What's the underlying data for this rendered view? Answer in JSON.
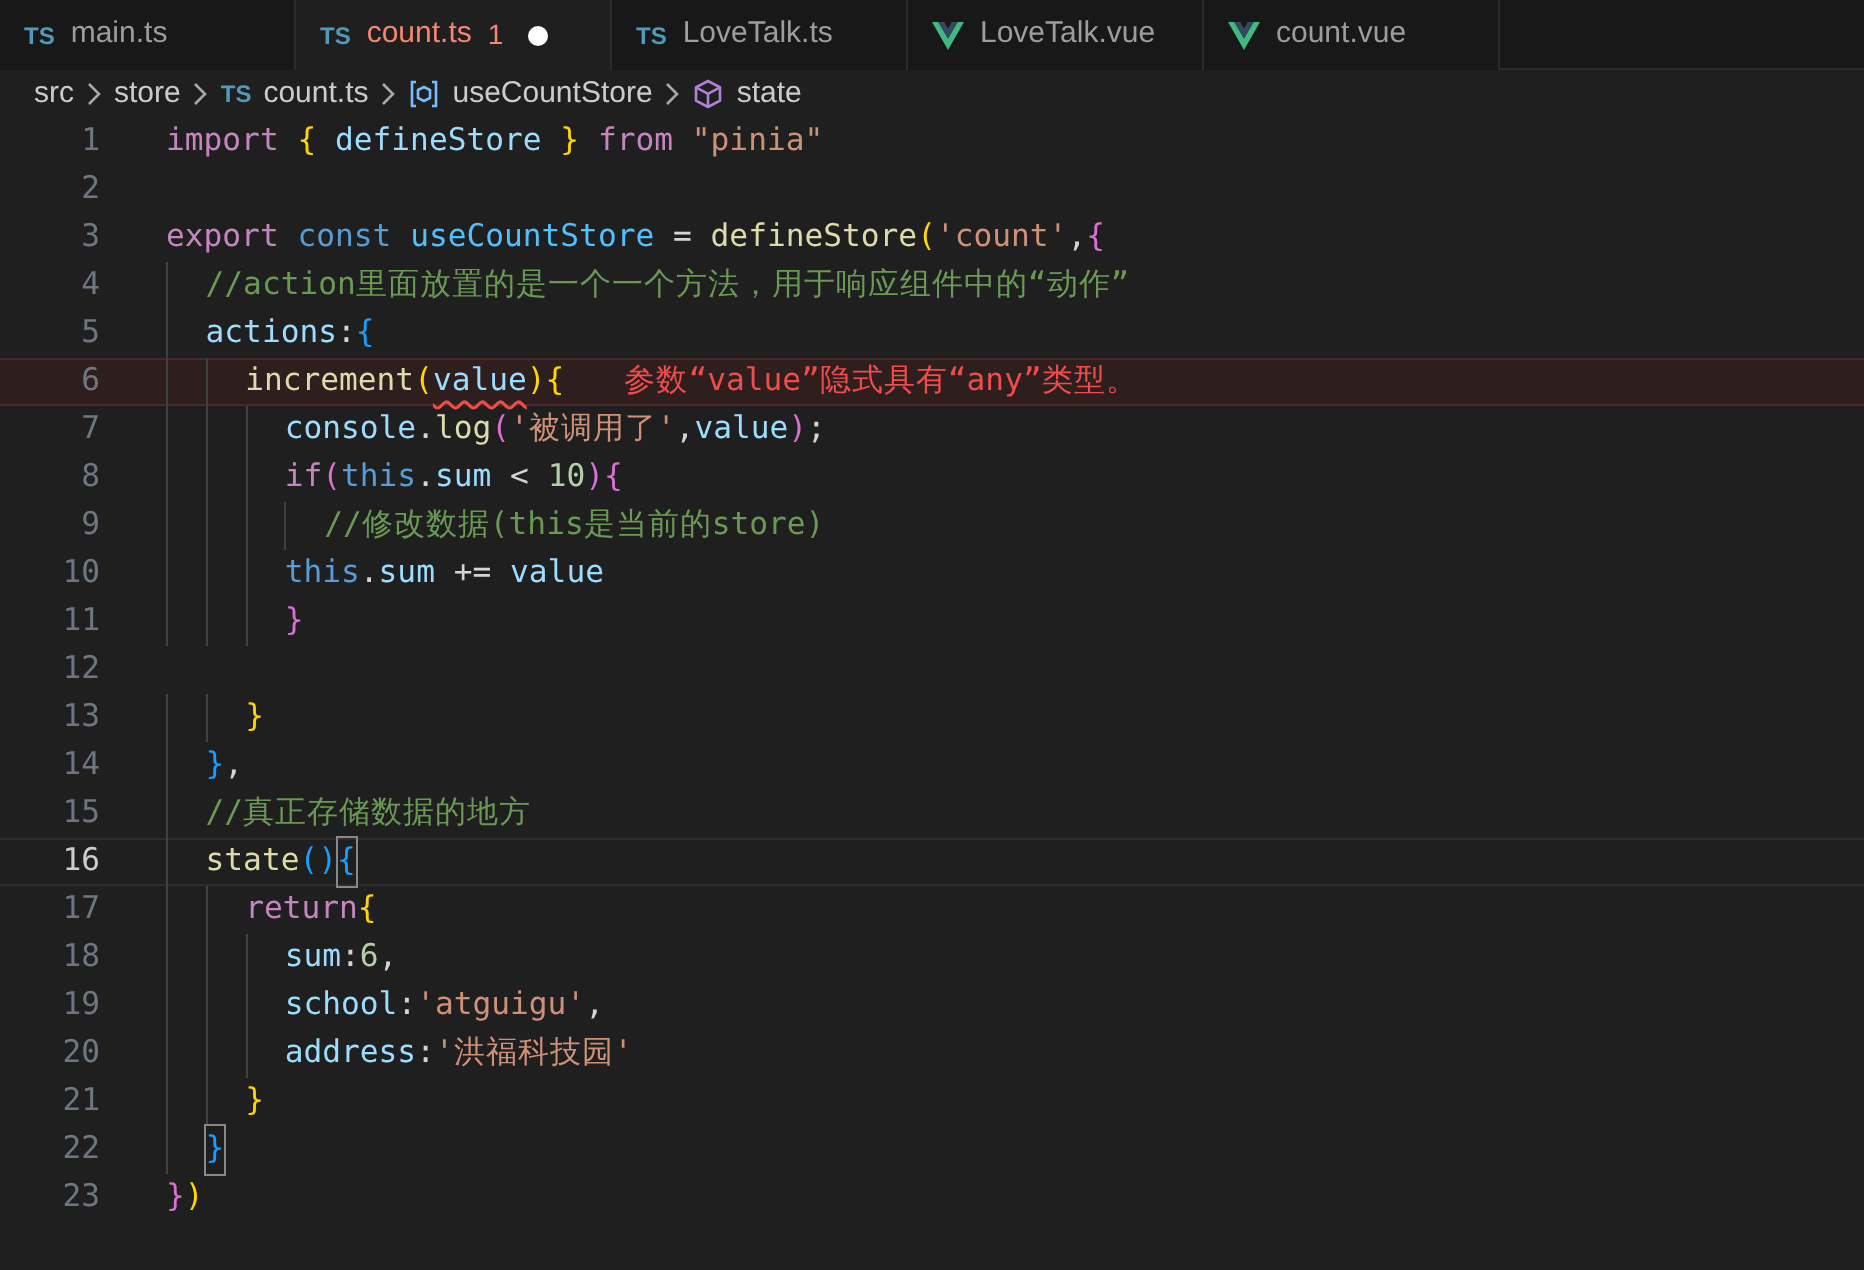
{
  "tabs": [
    {
      "label": "main.ts",
      "kind": "ts",
      "badge": "TS",
      "selected": false,
      "modified": false
    },
    {
      "label": "count.ts",
      "kind": "ts",
      "badge": "TS",
      "selected": true,
      "modified": true,
      "problems": "1"
    },
    {
      "label": "LoveTalk.ts",
      "kind": "ts",
      "badge": "TS",
      "selected": false,
      "modified": false
    },
    {
      "label": "LoveTalk.vue",
      "kind": "vue",
      "selected": false,
      "modified": false
    },
    {
      "label": "count.vue",
      "kind": "vue",
      "selected": false,
      "modified": false
    }
  ],
  "breadcrumb": [
    {
      "label": "src",
      "kind": "folder"
    },
    {
      "label": "store",
      "kind": "folder"
    },
    {
      "label": "count.ts",
      "kind": "ts",
      "badge": "TS"
    },
    {
      "label": "useCountStore",
      "kind": "module"
    },
    {
      "label": "state",
      "kind": "property"
    }
  ],
  "lines": [
    {
      "number": "1",
      "current": false,
      "tokens": [
        {
          "t": "import ",
          "color": "#c586c0"
        },
        {
          "t": "{",
          "color": "#ffd700"
        },
        {
          "t": " defineStore ",
          "color": "#9cdcfe"
        },
        {
          "t": "} ",
          "color": "#ffd700"
        },
        {
          "t": "from ",
          "color": "#c586c0"
        },
        {
          "t": "\"pinia\"",
          "color": "#ce9178"
        }
      ]
    },
    {
      "number": "2",
      "current": false
    },
    {
      "number": "3",
      "current": false,
      "tokens": [
        {
          "t": "export ",
          "color": "#c586c0"
        },
        {
          "t": "const ",
          "color": "#569cd6"
        },
        {
          "t": "useCountStore",
          "color": "#4fc1ff"
        },
        {
          "t": " = ",
          "color": "#d4d4d4"
        },
        {
          "t": "defineStore",
          "color": "#dcdcaa"
        },
        {
          "t": "(",
          "color": "#ffd700"
        },
        {
          "t": "'count'",
          "color": "#ce9178"
        },
        {
          "t": ",",
          "color": "#d4d4d4"
        },
        {
          "t": "{",
          "color": "#da70d6"
        }
      ]
    },
    {
      "number": "4",
      "current": false,
      "tokens": [
        {
          "t": "  //action里面放置的是一个一个方法，用于响应组件中的“动作”",
          "color": "#6a9955"
        }
      ]
    },
    {
      "number": "5",
      "current": false,
      "tokens": [
        {
          "t": "  actions",
          "color": "#9cdcfe"
        },
        {
          "t": ":",
          "color": "#d4d4d4"
        },
        {
          "t": "{",
          "color": "#179fff"
        }
      ]
    },
    {
      "number": "6",
      "current": false,
      "error": "参数“value”隐式具有“any”类型。",
      "tokens": [
        {
          "t": "    increment",
          "color": "#dcdcaa"
        },
        {
          "t": "(",
          "color": "#ffd700"
        },
        {
          "t": "value",
          "color": "#9cdcfe",
          "squiggle": true
        },
        {
          "t": ")",
          "color": "#ffd700"
        },
        {
          "t": "{",
          "color": "#ffd700"
        }
      ]
    },
    {
      "number": "7",
      "current": false,
      "tokens": [
        {
          "t": "      console",
          "color": "#9cdcfe"
        },
        {
          "t": ".",
          "color": "#d4d4d4"
        },
        {
          "t": "log",
          "color": "#dcdcaa"
        },
        {
          "t": "(",
          "color": "#da70d6"
        },
        {
          "t": "'被调用了'",
          "color": "#ce9178"
        },
        {
          "t": ",",
          "color": "#d4d4d4"
        },
        {
          "t": "value",
          "color": "#9cdcfe"
        },
        {
          "t": ")",
          "color": "#da70d6"
        },
        {
          "t": ";",
          "color": "#d4d4d4"
        }
      ]
    },
    {
      "number": "8",
      "current": false,
      "tokens": [
        {
          "t": "      if",
          "color": "#c586c0"
        },
        {
          "t": "(",
          "color": "#da70d6"
        },
        {
          "t": "this",
          "color": "#569cd6"
        },
        {
          "t": ".",
          "color": "#d4d4d4"
        },
        {
          "t": "sum",
          "color": "#9cdcfe"
        },
        {
          "t": " < ",
          "color": "#d4d4d4"
        },
        {
          "t": "10",
          "color": "#b5cea8"
        },
        {
          "t": ")",
          "color": "#da70d6"
        },
        {
          "t": "{",
          "color": "#da70d6"
        }
      ]
    },
    {
      "number": "9",
      "current": false,
      "tokens": [
        {
          "t": "        //修改数据(this是当前的store)",
          "color": "#6a9955"
        }
      ]
    },
    {
      "number": "10",
      "current": false,
      "tokens": [
        {
          "t": "      this",
          "color": "#569cd6"
        },
        {
          "t": ".",
          "color": "#d4d4d4"
        },
        {
          "t": "sum",
          "color": "#9cdcfe"
        },
        {
          "t": " += ",
          "color": "#d4d4d4"
        },
        {
          "t": "value",
          "color": "#9cdcfe"
        }
      ]
    },
    {
      "number": "11",
      "current": false,
      "tokens": [
        {
          "t": "      }",
          "color": "#da70d6"
        }
      ]
    },
    {
      "number": "12",
      "current": false
    },
    {
      "number": "13",
      "current": false,
      "tokens": [
        {
          "t": "    }",
          "color": "#ffd700"
        }
      ]
    },
    {
      "number": "14",
      "current": false,
      "tokens": [
        {
          "t": "  }",
          "color": "#179fff"
        },
        {
          "t": ",",
          "color": "#d4d4d4"
        }
      ]
    },
    {
      "number": "15",
      "current": false,
      "tokens": [
        {
          "t": "  //真正存储数据的地方",
          "color": "#6a9955"
        }
      ]
    },
    {
      "number": "16",
      "current": true,
      "tokens": [
        {
          "t": "  state",
          "color": "#dcdcaa"
        },
        {
          "t": "()",
          "color": "#179fff"
        },
        {
          "t": "{",
          "color": "#179fff",
          "matched": true
        }
      ]
    },
    {
      "number": "17",
      "current": false,
      "tokens": [
        {
          "t": "    return",
          "color": "#c586c0"
        },
        {
          "t": "{",
          "color": "#ffd700"
        }
      ]
    },
    {
      "number": "18",
      "current": false,
      "tokens": [
        {
          "t": "      sum",
          "color": "#9cdcfe"
        },
        {
          "t": ":",
          "color": "#d4d4d4"
        },
        {
          "t": "6",
          "color": "#b5cea8"
        },
        {
          "t": ",",
          "color": "#d4d4d4"
        }
      ]
    },
    {
      "number": "19",
      "current": false,
      "tokens": [
        {
          "t": "      school",
          "color": "#9cdcfe"
        },
        {
          "t": ":",
          "color": "#d4d4d4"
        },
        {
          "t": "'atguigu'",
          "color": "#ce9178"
        },
        {
          "t": ",",
          "color": "#d4d4d4"
        }
      ]
    },
    {
      "number": "20",
      "current": false,
      "tokens": [
        {
          "t": "      address",
          "color": "#9cdcfe"
        },
        {
          "t": ":",
          "color": "#d4d4d4"
        },
        {
          "t": "'洪福科技园'",
          "color": "#ce9178"
        }
      ]
    },
    {
      "number": "21",
      "current": false,
      "tokens": [
        {
          "t": "    }",
          "color": "#ffd700"
        }
      ]
    },
    {
      "number": "22",
      "current": false,
      "tokens": [
        {
          "t": "  }",
          "color": "#179fff",
          "matched": true
        }
      ]
    },
    {
      "number": "23",
      "current": false,
      "tokens": [
        {
          "t": "}",
          "color": "#da70d6"
        },
        {
          "t": ")",
          "color": "#ffd700"
        }
      ]
    }
  ]
}
